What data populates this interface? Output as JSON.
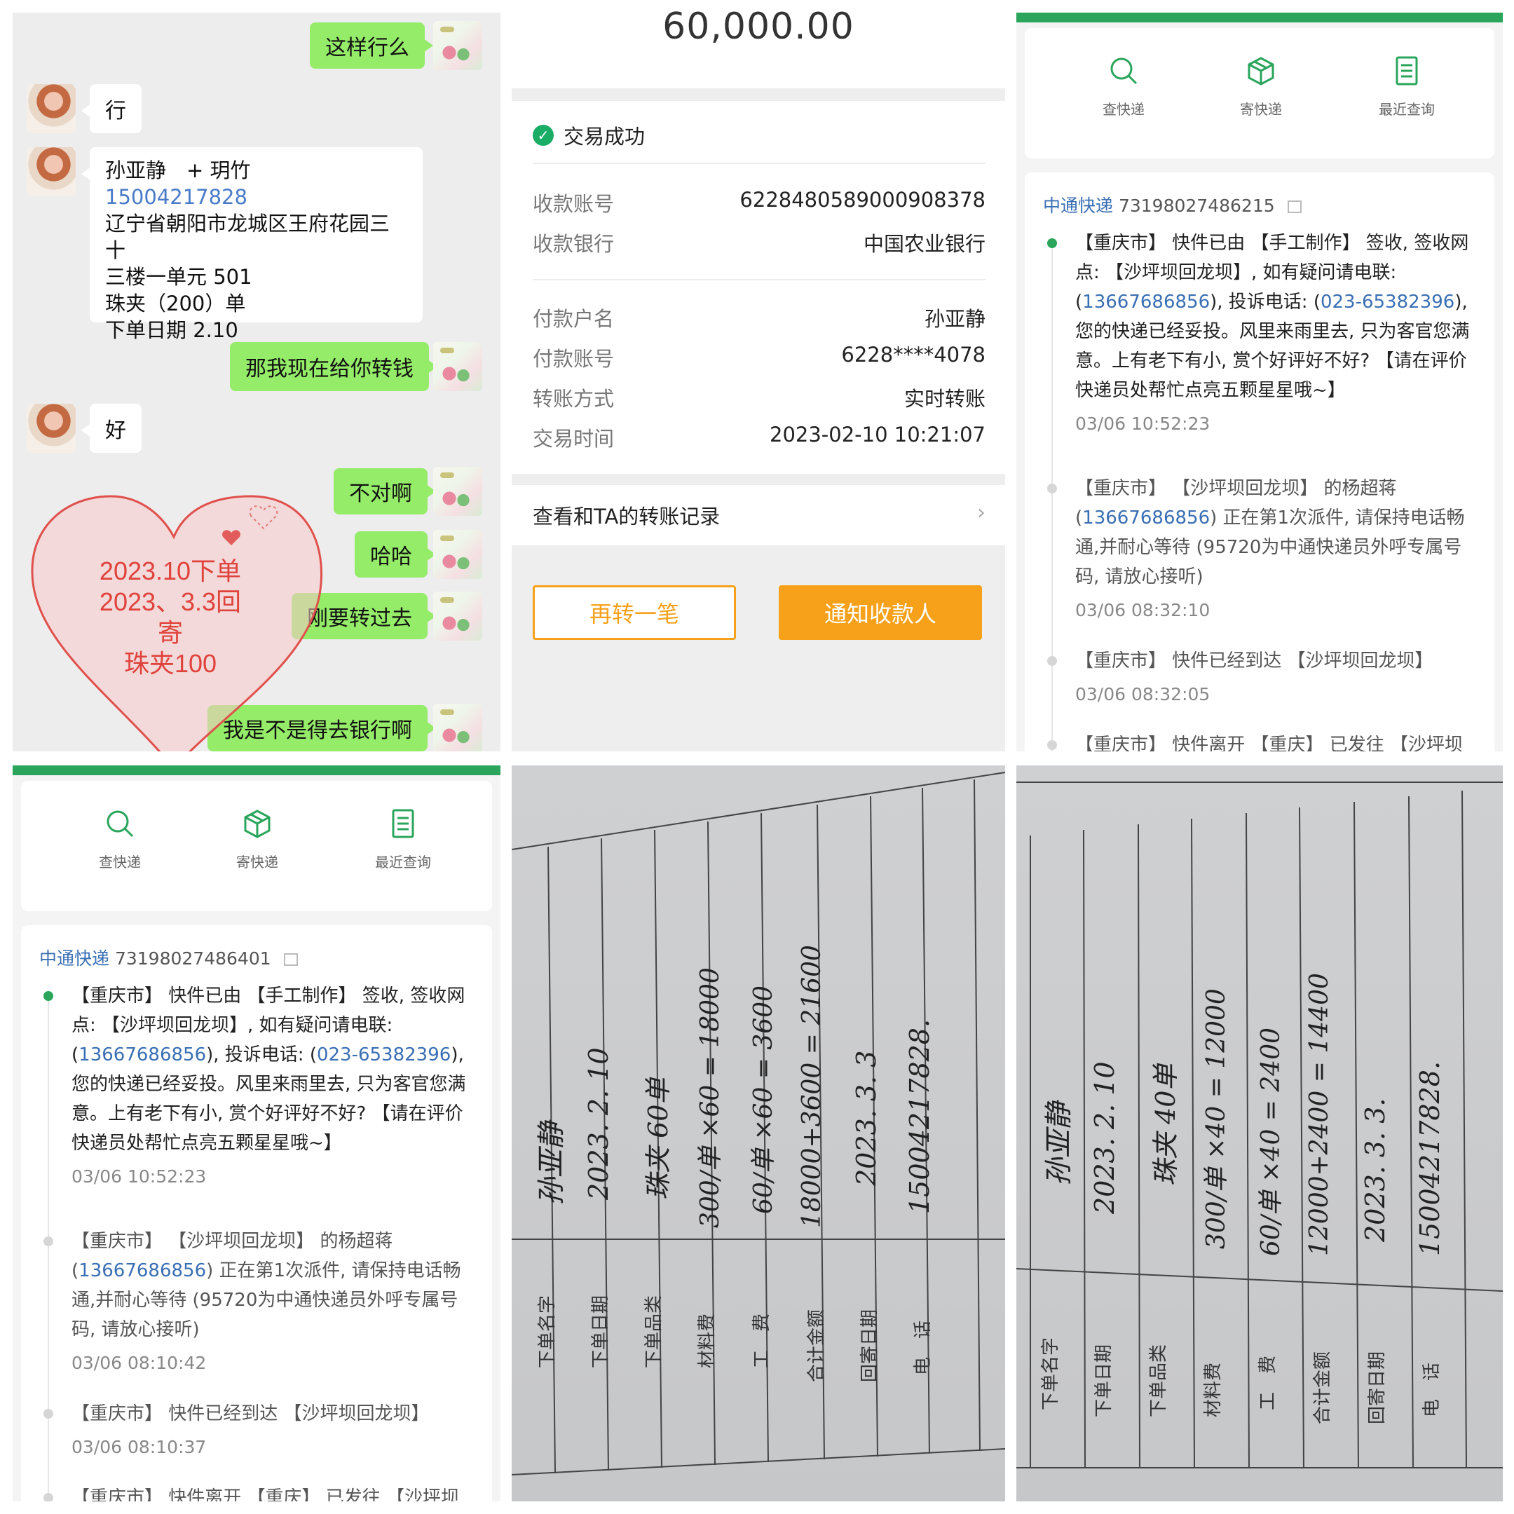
{
  "chat": {
    "messages": [
      {
        "from": "me",
        "text": "这样行么"
      },
      {
        "from": "them",
        "text": "行"
      },
      {
        "from": "them",
        "type": "contact",
        "lines": [
          "孙亚静　+ 玥竹",
          "15004217828",
          "辽宁省朝阳市龙城区王府花园三十",
          "三楼一单元 501",
          "珠夹（200）单",
          "下单日期 2.10"
        ]
      },
      {
        "from": "me",
        "text": "那我现在给你转钱"
      },
      {
        "from": "them",
        "text": "好"
      },
      {
        "from": "me",
        "text": "不对啊"
      },
      {
        "from": "me",
        "text": "哈哈"
      },
      {
        "from": "me",
        "text": "刚要转过去"
      },
      {
        "from": "me",
        "text": "我是不是得去银行啊"
      }
    ],
    "heart_note": [
      "2023.10下单",
      "2023、3.3回",
      "寄",
      "珠夹100"
    ]
  },
  "payment": {
    "amount": "60,000.00",
    "status": "交易成功",
    "receive_account_label": "收款账号",
    "receive_account": "6228480589000908378",
    "receive_bank_label": "收款银行",
    "receive_bank": "中国农业银行",
    "payer_name_label": "付款户名",
    "payer_name": "孙亚静",
    "payer_account_label": "付款账号",
    "payer_account": "6228****4078",
    "transfer_type_label": "转账方式",
    "transfer_type": "实时转账",
    "time_label": "交易时间",
    "time": "2023-02-10 10:21:07",
    "records_link": "查看和TA的转账记录",
    "again_button": "再转一笔",
    "notify_button": "通知收款人",
    "accent": "#f7a11a"
  },
  "express1": {
    "nav": [
      "查快递",
      "寄快递",
      "最近查询"
    ],
    "carrier": "中通快递",
    "tracking_no": "73198027486215",
    "events": [
      {
        "pre": "【重庆市】 快件已由 【手工制作】 签收, 签收网点: 【沙坪坝回龙坝】, 如有疑问请电联: (",
        "link1": "13667686856",
        "mid": "), 投诉电话: (",
        "link2": "023-65382396",
        "post": "), 您的快递已经妥投。风里来雨里去, 只为客官您满意。上有老下有小, 赏个好评好不好? 【请在评价快递员处帮忙点亮五颗星星哦~】",
        "time": "03/06 10:52:23"
      },
      {
        "pre": "【重庆市】 【沙坪坝回龙坝】 的杨超蒋 (",
        "link1": "13667686856",
        "post": ") 正在第1次派件, 请保持电话畅通,并耐心等待 (95720为中通快递员外呼专属号码, 请放心接听)",
        "time": "03/06 08:32:10"
      },
      {
        "pre": "【重庆市】 快件已经到达 【沙坪坝回龙坝】",
        "time": "03/06 08:32:05"
      },
      {
        "pre": "【重庆市】 快件离开 【重庆】 已发往 【沙坪坝"
      }
    ],
    "brand_color": "#2aa55b"
  },
  "express2": {
    "nav": [
      "查快递",
      "寄快递",
      "最近查询"
    ],
    "carrier": "中通快递",
    "tracking_no": "73198027486401",
    "events": [
      {
        "pre": "【重庆市】 快件已由 【手工制作】 签收, 签收网点: 【沙坪坝回龙坝】, 如有疑问请电联: (",
        "link1": "13667686856",
        "mid": "), 投诉电话: (",
        "link2": "023-65382396",
        "post": "), 您的快递已经妥投。风里来雨里去, 只为客官您满意。上有老下有小, 赏个好评好不好? 【请在评价快递员处帮忙点亮五颗星星哦~】",
        "time": "03/06 10:52:23"
      },
      {
        "pre": "【重庆市】 【沙坪坝回龙坝】 的杨超蒋 (",
        "link1": "13667686856",
        "post": ") 正在第1次派件, 请保持电话畅通,并耐心等待 (95720为中通快递员外呼专属号码, 请放心接听)",
        "time": "03/06 08:10:42"
      },
      {
        "pre": "【重庆市】 快件已经到达 【沙坪坝回龙坝】",
        "time": "03/06 08:10:37"
      },
      {
        "pre": "【重庆市】 快件离开 【重庆】 已发往 【沙坪坝"
      }
    ]
  },
  "form1": {
    "labels": [
      "下单名字",
      "下单日期",
      "下单品类",
      "材料费",
      "工　费",
      "合计金额",
      "回寄日期",
      "电　话"
    ],
    "values": [
      "孙亚静",
      "2023. 2. 10",
      "珠夹 60单",
      "300/单 ×60 = 18000",
      "60/单 ×60 = 3600",
      "18000+3600 = 21600",
      "2023. 3. 3",
      "15004217828."
    ]
  },
  "form2": {
    "labels": [
      "下单名字",
      "下单日期",
      "下单品类",
      "材料费",
      "工　费",
      "合计金额",
      "回寄日期",
      "电　话"
    ],
    "values": [
      "孙亚静",
      "2023. 2. 10",
      "珠夹 40单",
      "300/单 ×40 = 12000",
      "60/单 ×40 = 2400",
      "12000+2400 = 14400",
      "2023. 3. 3.",
      "15004217828."
    ]
  }
}
